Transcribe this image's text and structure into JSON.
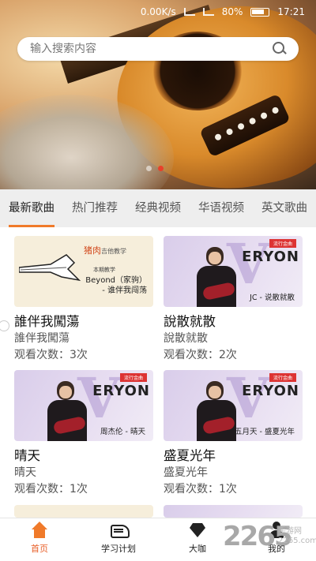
{
  "status_bar": {
    "net_speed": "0.00K/s",
    "battery": "80%",
    "time": "17:21"
  },
  "search": {
    "placeholder": "输入搜索内容",
    "value": ""
  },
  "banner": {
    "slides": 2,
    "active_slide": 2
  },
  "tabs": [
    {
      "label": "最新歌曲",
      "active": true
    },
    {
      "label": "热门推荐",
      "active": false
    },
    {
      "label": "经典视频",
      "active": false
    },
    {
      "label": "华语视频",
      "active": false
    },
    {
      "label": "英文歌曲",
      "active": false
    }
  ],
  "videos": [
    {
      "title": "誰伴我闖蕩",
      "subtitle": "誰伴我闖蕩",
      "views": "观看次数：3次",
      "thumb_style": "cream",
      "thumb_brand": "猪肉",
      "thumb_brand_suffix": "吉他教学",
      "thumb_small": "本期教学",
      "thumb_caption_1": "Beyond（家驹）",
      "thumb_caption_2": "- 谁伴我闯荡"
    },
    {
      "title": "說散就散",
      "subtitle": "說散就散",
      "views": "观看次数：2次",
      "thumb_style": "lav",
      "thumb_tag": "流行金曲",
      "thumb_logo": "ERYON",
      "thumb_logo_initial": "V",
      "thumb_caption": "JC - 说散就散"
    },
    {
      "title": "晴天",
      "subtitle": "晴天",
      "views": "观看次数：1次",
      "thumb_style": "lav",
      "thumb_tag": "流行金曲",
      "thumb_logo": "ERYON",
      "thumb_logo_initial": "V",
      "thumb_caption": "周杰伦 - 晴天"
    },
    {
      "title": "盛夏光年",
      "subtitle": "盛夏光年",
      "views": "观看次数：1次",
      "thumb_style": "lav",
      "thumb_tag": "流行金曲",
      "thumb_logo": "ERYON",
      "thumb_logo_initial": "V",
      "thumb_caption": "五月天 - 盛夏光年"
    }
  ],
  "bottom_nav": [
    {
      "label": "首页",
      "icon": "home-icon",
      "active": true
    },
    {
      "label": "学习计划",
      "icon": "study-plan-icon",
      "active": false
    },
    {
      "label": "大咖",
      "icon": "diamond-icon",
      "active": false
    },
    {
      "label": "我的",
      "icon": "profile-icon",
      "active": false
    }
  ],
  "watermark": {
    "number": "2265",
    "site": "手游网",
    "domain": "2265.com"
  },
  "colors": {
    "accent": "#f07a2a",
    "tab_bar_bg": "#eeeeee",
    "banner_dot_active": "#e8402a"
  }
}
